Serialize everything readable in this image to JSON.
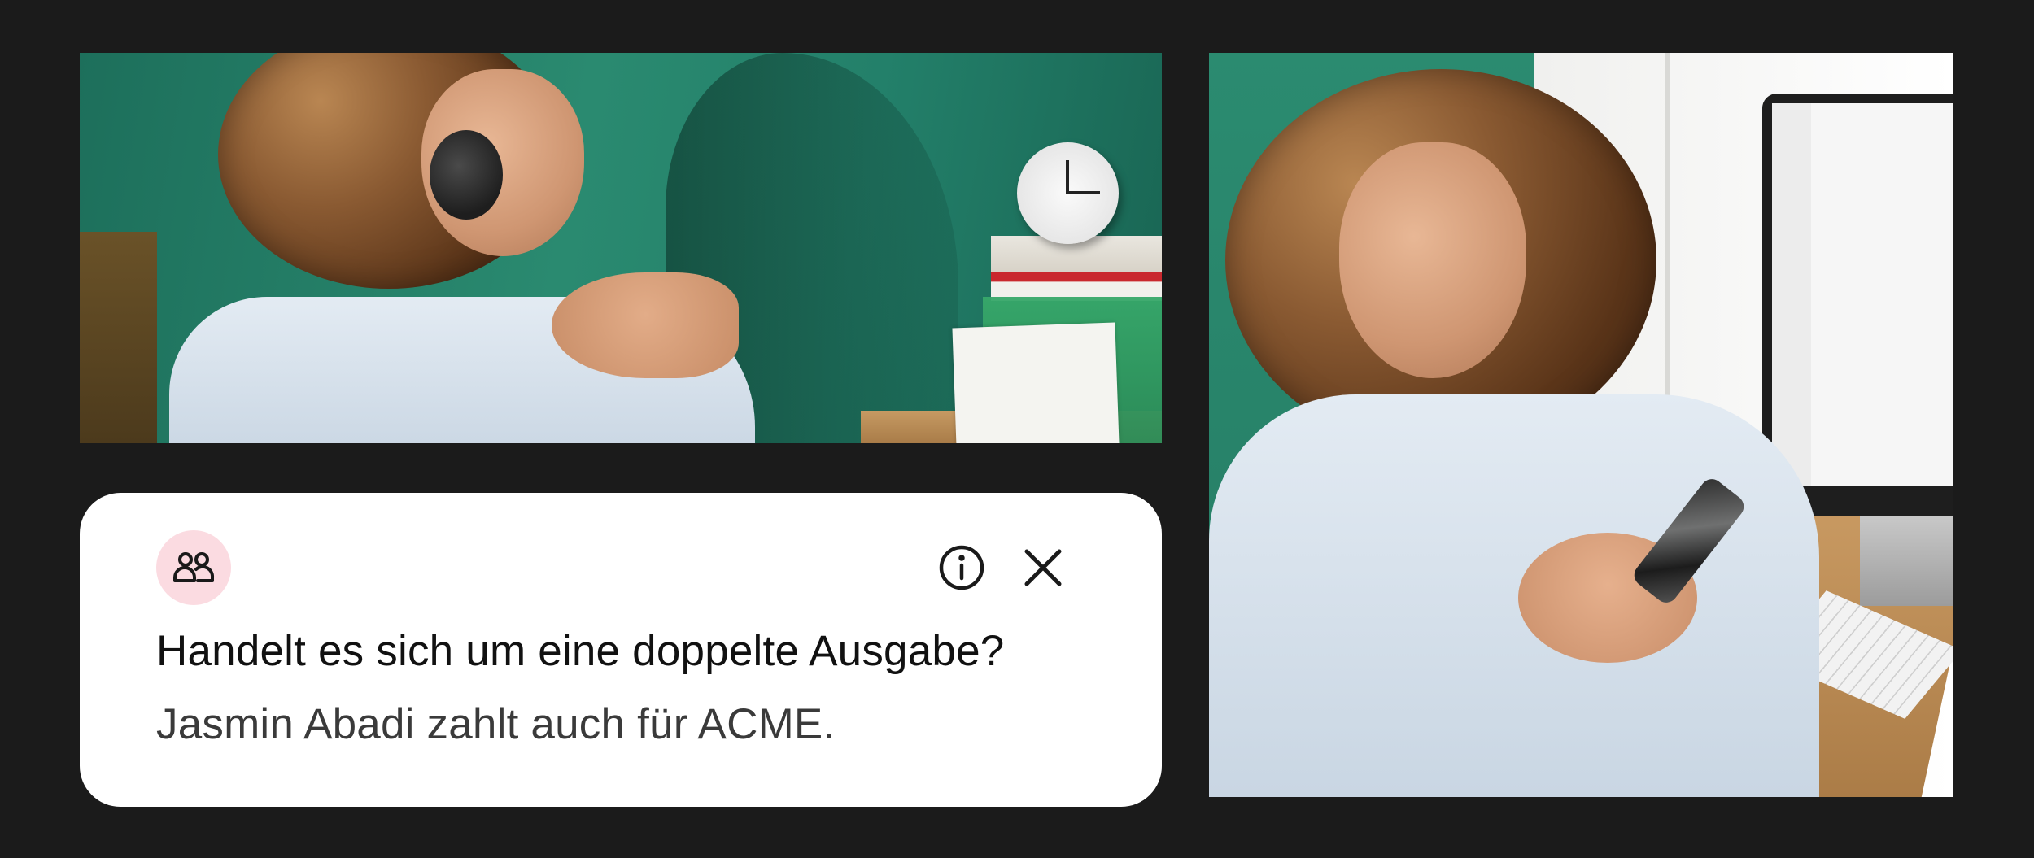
{
  "notification": {
    "title": "Handelt es sich um eine doppelte Ausgabe?",
    "message": "Jasmin Abadi zahlt auch für ACME.",
    "avatar_icon": "users-icon",
    "info_icon": "info-icon",
    "close_icon": "close-icon",
    "avatar_bg_color": "#fbdbe1",
    "card_bg_color": "#ffffff"
  },
  "background_color": "#1b1b1b"
}
